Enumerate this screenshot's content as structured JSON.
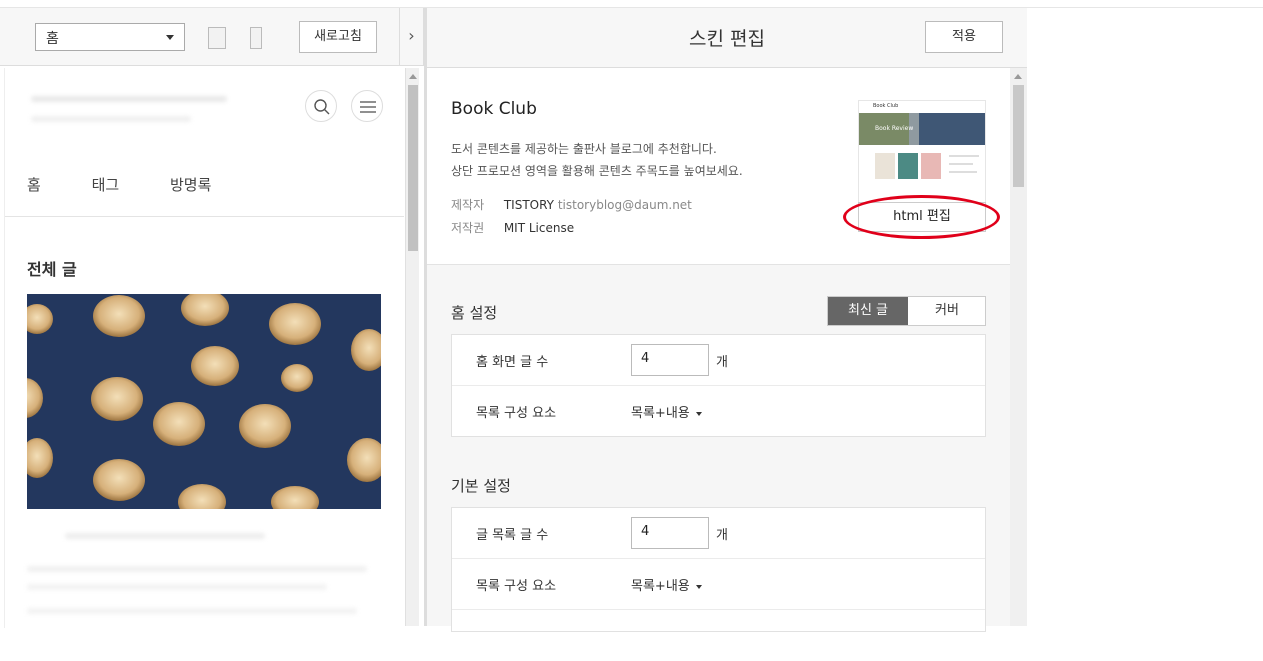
{
  "toolbar": {
    "page_select_value": "홈",
    "refresh_label": "새로고침",
    "collapse_glyph": "›"
  },
  "preview": {
    "nav_items": [
      "홈",
      "태그",
      "방명록"
    ],
    "section_title": "전체 글"
  },
  "editor": {
    "title": "스킨 편집",
    "apply_label": "적용",
    "skin": {
      "name": "Book Club",
      "description_lines": [
        "도서 콘텐츠를 제공하는 출판사 블로그에 추천합니다.",
        "상단 프로모션 영역을 활용해 콘텐츠 주목도를 높여보세요."
      ],
      "author_key": "제작자",
      "author_name": "TISTORY",
      "author_email": "tistoryblog@daum.net",
      "license_key": "저작권",
      "license_value": "MIT License",
      "html_edit_label": "html 편집",
      "thumb_title": "Book Club",
      "thumb_banner": "Book Review"
    },
    "home_settings": {
      "title": "홈 설정",
      "tab_latest": "최신 글",
      "tab_cover": "커버",
      "rows": [
        {
          "label": "홈 화면 글 수",
          "value": "4",
          "unit": "개"
        },
        {
          "label": "목록 구성 요소",
          "value": "목록+내용"
        }
      ]
    },
    "basic_settings": {
      "title": "기본 설정",
      "rows": [
        {
          "label": "글 목록 글 수",
          "value": "4",
          "unit": "개"
        },
        {
          "label": "목록 구성 요소",
          "value": "목록+내용"
        }
      ]
    }
  },
  "colors": {
    "highlight_oval": "#e0001a",
    "active_tab": "#666666",
    "preview_image_bg": "#23375e"
  }
}
